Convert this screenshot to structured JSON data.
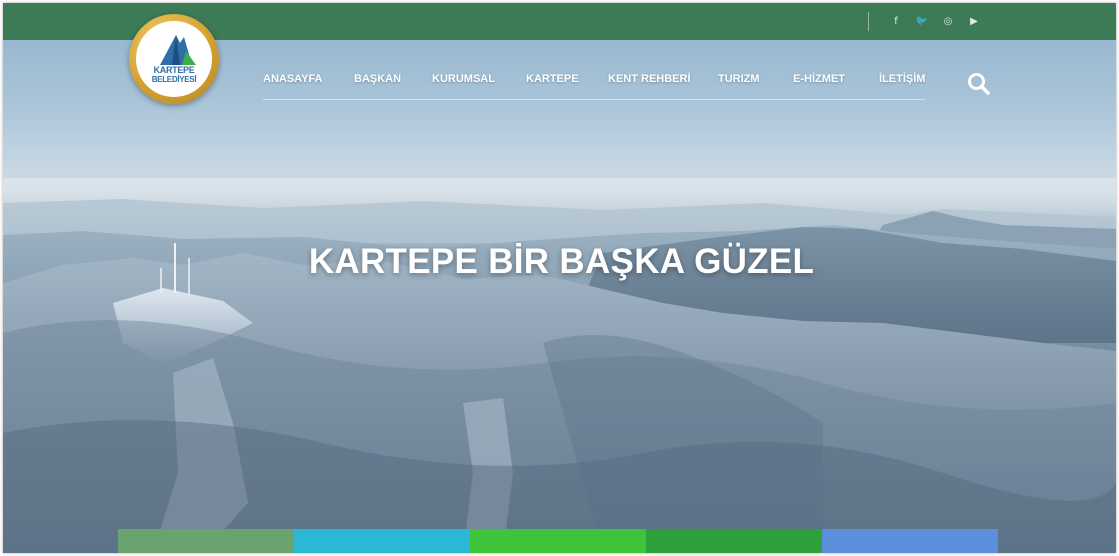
{
  "header": {
    "colors": {
      "topbar": "#3d7a56",
      "logo_ring": "#d4a334"
    },
    "social": [
      {
        "icon": "facebook-icon",
        "glyph": "f"
      },
      {
        "icon": "twitter-icon",
        "glyph": "🐦"
      },
      {
        "icon": "instagram-icon",
        "glyph": "◎"
      },
      {
        "icon": "youtube-icon",
        "glyph": "▶"
      }
    ]
  },
  "logo": {
    "line1": "KARTEPE",
    "line2": "BELEDİYESİ"
  },
  "nav": {
    "items": [
      {
        "label": "ANASAYFA"
      },
      {
        "label": "BAŞKAN"
      },
      {
        "label": "KURUMSAL"
      },
      {
        "label": "KARTEPE"
      },
      {
        "label": "KENT REHBERİ"
      },
      {
        "label": "TURIZM"
      },
      {
        "label": "E-HİZMET"
      },
      {
        "label": "İLETİŞİM"
      }
    ],
    "search_icon": "search-icon"
  },
  "hero": {
    "headline": "KARTEPE BİR BAŞKA GÜZEL"
  },
  "tiles": [
    {
      "color": "#6aa36f"
    },
    {
      "color": "#2bb7d6"
    },
    {
      "color": "#3ec43a"
    },
    {
      "color": "#2fa13c"
    },
    {
      "color": "#5b8fdc"
    }
  ]
}
